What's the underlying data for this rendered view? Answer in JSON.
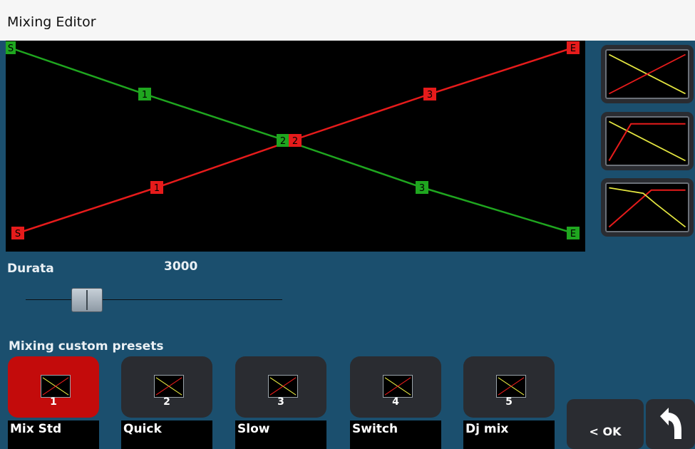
{
  "window": {
    "title": "Mixing Editor"
  },
  "colors": {
    "green": "#1fa61f",
    "red": "#e61b1b",
    "yellow": "#e4e640",
    "background": "#1b4f6e",
    "active_preset": "#c30b0b"
  },
  "graph": {
    "green_curve": {
      "points": [
        {
          "label": "S"
        },
        {
          "label": "1"
        },
        {
          "label": "2"
        },
        {
          "label": "3"
        },
        {
          "label": "E"
        }
      ]
    },
    "red_curve": {
      "points": [
        {
          "label": "S"
        },
        {
          "label": "1"
        },
        {
          "label": "2"
        },
        {
          "label": "3"
        },
        {
          "label": "E"
        }
      ]
    }
  },
  "curve_buttons": [
    {
      "name": "crossfade-linear"
    },
    {
      "name": "crossfade-fast-in"
    },
    {
      "name": "crossfade-custom"
    }
  ],
  "duration": {
    "label": "Durata",
    "value": "3000",
    "slider_fraction": 0.24
  },
  "presets": {
    "label": "Mixing custom presets",
    "items": [
      {
        "number": "1",
        "name": "Mix Std",
        "active": true
      },
      {
        "number": "2",
        "name": "Quick",
        "active": false
      },
      {
        "number": "3",
        "name": "Slow",
        "active": false
      },
      {
        "number": "4",
        "name": "Switch",
        "active": false
      },
      {
        "number": "5",
        "name": "Dj mix",
        "active": false
      }
    ]
  },
  "actions": {
    "ok_label": "< OK",
    "back_icon": "curved-back-arrow-icon"
  }
}
